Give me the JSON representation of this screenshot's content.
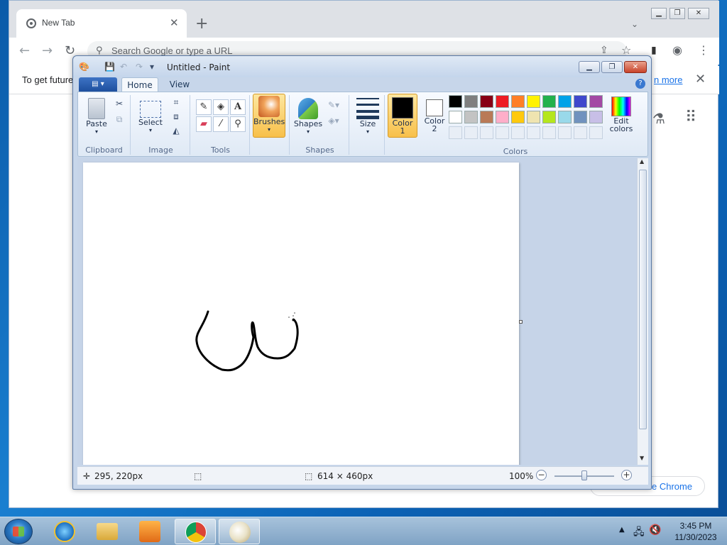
{
  "chrome": {
    "tab_title": "New Tab",
    "tab_close": "✕",
    "new_tab": "+",
    "omnibox_placeholder": "Search Google or type a URL",
    "infobar_message": "To get future",
    "infobar_link": "n more",
    "customize_label": "e Chrome"
  },
  "paint": {
    "title": "Untitled - Paint",
    "tabs": {
      "home": "Home",
      "view": "View"
    },
    "groups": {
      "clipboard": {
        "label": "Clipboard",
        "paste": "Paste"
      },
      "image": {
        "label": "Image",
        "select": "Select"
      },
      "tools": {
        "label": "Tools"
      },
      "brushes": {
        "label": "Brushes"
      },
      "shapes": {
        "label": "Shapes",
        "shapes_btn": "Shapes"
      },
      "size": {
        "label": "Size"
      },
      "colors": {
        "label": "Colors",
        "color1": "Color\n1",
        "color1_line1": "Color",
        "color1_line2": "1",
        "color2_line1": "Color",
        "color2_line2": "2",
        "edit_line1": "Edit",
        "edit_line2": "colors",
        "color1_value": "#000000",
        "color2_value": "#ffffff",
        "palette_row1": [
          "#000000",
          "#7f7f7f",
          "#880015",
          "#ed1c24",
          "#ff7f27",
          "#fff200",
          "#22b14c",
          "#00a2e8",
          "#3f48cc",
          "#a349a4"
        ],
        "palette_row2": [
          "#ffffff",
          "#c3c3c3",
          "#b97a57",
          "#ffaec9",
          "#ffc90e",
          "#efe4b0",
          "#b5e61d",
          "#99d9ea",
          "#7092be",
          "#c8bfe7"
        ]
      }
    },
    "status": {
      "cursor_pos": "295, 220px",
      "image_size": "614 × 460px",
      "zoom": "100%"
    }
  },
  "taskbar": {
    "time": "3:45 PM",
    "date": "11/30/2023"
  }
}
